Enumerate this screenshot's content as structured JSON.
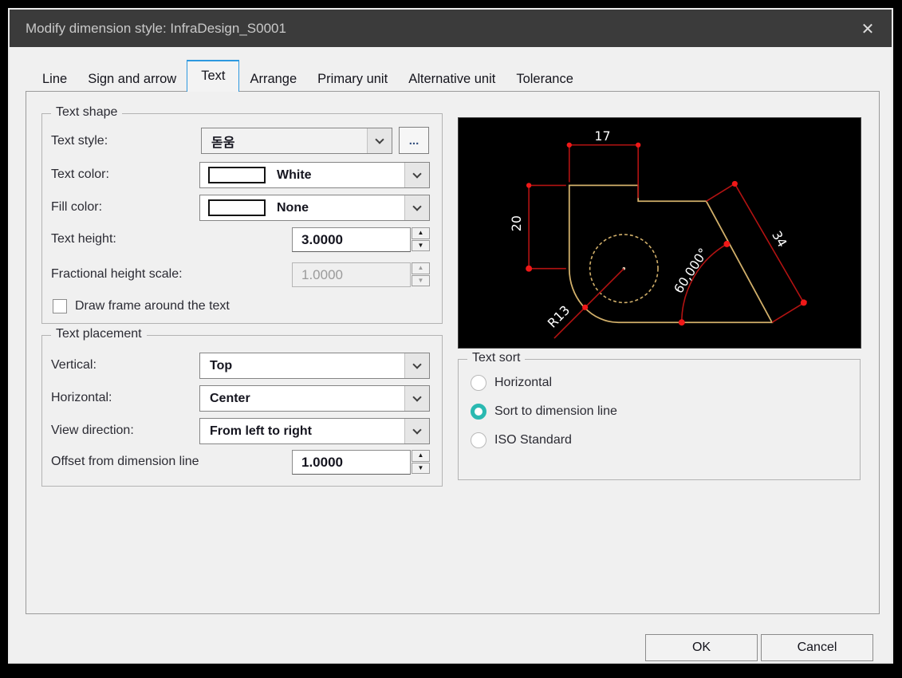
{
  "window": {
    "title": "Modify dimension style: InfraDesign_S0001"
  },
  "icons": {
    "close": "✕",
    "spin_up": "▲",
    "spin_down": "▼"
  },
  "tabs": [
    {
      "label": "Line"
    },
    {
      "label": "Sign and arrow"
    },
    {
      "label": "Text"
    },
    {
      "label": "Arrange"
    },
    {
      "label": "Primary unit"
    },
    {
      "label": "Alternative unit"
    },
    {
      "label": "Tolerance"
    }
  ],
  "selected_tab": "Text",
  "text_shape": {
    "group_label": "Text shape",
    "text_style": {
      "label": "Text style:",
      "value": "돋움",
      "browse_label": "..."
    },
    "text_color": {
      "label": "Text color:",
      "value": "White",
      "swatch": "#ffffff"
    },
    "fill_color": {
      "label": "Fill color:",
      "value": "None",
      "swatch": "#ffffff"
    },
    "text_height": {
      "label": "Text height:",
      "value": "3.0000"
    },
    "fractional_height_scale": {
      "label": "Fractional height scale:",
      "value": "1.0000",
      "disabled": true
    },
    "draw_frame": {
      "label": "Draw frame around the text",
      "checked": false
    }
  },
  "text_placement": {
    "group_label": "Text placement",
    "vertical": {
      "label": "Vertical:",
      "value": "Top"
    },
    "horizontal": {
      "label": "Horizontal:",
      "value": "Center"
    },
    "view_direction": {
      "label": "View direction:",
      "value": "From left to right"
    },
    "offset": {
      "label": "Offset from dimension line",
      "value": "1.0000"
    }
  },
  "preview": {
    "labels": {
      "top": "17",
      "left": "20",
      "diagonal": "34",
      "angle": "60,000°",
      "radius": "R13"
    },
    "colors": {
      "background": "#000000",
      "outline": "#d2b06a",
      "dimension": "#b31312",
      "marker": "#f01818",
      "label": "#ffffff"
    }
  },
  "text_sort": {
    "group_label": "Text sort",
    "accent_color": "#2ab9b1",
    "options": [
      {
        "label": "Horizontal",
        "selected": false
      },
      {
        "label": "Sort to dimension line",
        "selected": true
      },
      {
        "label": "ISO Standard",
        "selected": false
      }
    ]
  },
  "footer": {
    "ok_label": "OK",
    "cancel_label": "Cancel"
  }
}
